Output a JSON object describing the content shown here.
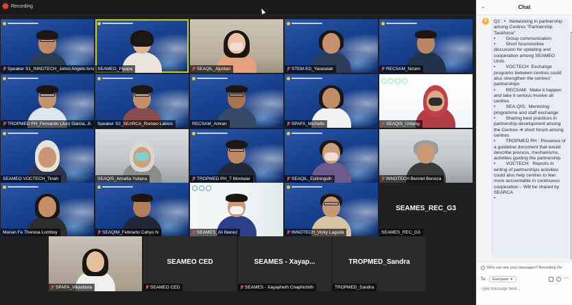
{
  "topbar": {
    "recording_label": "Recording"
  },
  "participants": [
    {
      "name": "Speaker S1_INNOTECH_Jelico Angelo Arresgado",
      "muted": true
    },
    {
      "name": "SEAMEO_Piyapa",
      "muted": false
    },
    {
      "name": "SEAQIL_Ajuntan",
      "muted": true
    },
    {
      "name": "STEM-ED_Yaowalak",
      "muted": true
    },
    {
      "name": "RECSAM_Nizam",
      "muted": true
    },
    {
      "name": "TROPMED PH_Fernando (Jun) Garcia, Jr.",
      "muted": true
    },
    {
      "name": "Speaker S2_SEARCA_Romeo Labios",
      "muted": false
    },
    {
      "name": "RECSAM_Amran",
      "muted": false
    },
    {
      "name": "SPAFA_Michelle",
      "muted": true
    },
    {
      "name": "SEAQIS_Untang",
      "muted": true
    },
    {
      "name": "SEAMEO VOCTECH_Tinah",
      "muted": false
    },
    {
      "name": "SEAQIS_Amallia Yuliana",
      "muted": false
    },
    {
      "name": "TROPMED PH_T Montalar",
      "muted": true
    },
    {
      "name": "SEAQIL_Estiningsih",
      "muted": true
    },
    {
      "name": "INNOTECH Bennet Benoza",
      "muted": true
    },
    {
      "name": "Marian Fe Theresa Lomboy",
      "muted": false
    },
    {
      "name": "SEAQIM_Febriarto Cahyo N",
      "muted": true
    },
    {
      "name": "SEAMES_Ali Ibanez",
      "muted": true
    },
    {
      "name": "INNOTECH_Vicky Laguda",
      "muted": true
    },
    {
      "name": "SEAMES_REC_G3",
      "muted": false,
      "display": "SEAMES_REC_G3"
    }
  ],
  "bottom_row": [
    {
      "name": "SPAFA_Vikantana",
      "muted": true
    },
    {
      "name": "SEAMEO CED",
      "muted": true,
      "display": "SEAMEO CED"
    },
    {
      "name": "SEAMES - Xayapheth Chaphichith",
      "muted": true,
      "display": "SEAMES - Xayap..."
    },
    {
      "name": "TROPMED_Sandra",
      "muted": false,
      "display": "TROPMED_Sandra"
    }
  ],
  "chat": {
    "title": "Chat",
    "avatar_initial": "S",
    "message": "Q2 : •   Networking in partnership among Centres \"Partnership Taskforce\"\n•        Group communication\n•        Short forum/online discussion for updating and cooperation among SEAMEO Units\n•        VOCTECH: Exchange programs between centres could also strengthen the centres' partnerships\n•        RECSAM:  Make it happen and take it serious involve all centres\n•        SEA-QIS:  Mentoring programme and staff exchange\n•        Sharing best practices in partnership development among the Centres ➔ short forum among centres\n•        TROPMED PH : Presence of a guideline document that would describe process, mechanisms, activities guiding the partnership\n•        VOCTECH:  Reports in writing of partnerships activities could also help centres to feel more accountable in continuous cooperation – Will be shared by SEARCA\n•",
    "privacy_notice": "Who can see your messages? Recording On",
    "to_label": "To:",
    "recipient": "Everyone",
    "input_placeholder": "Type message here..."
  },
  "colors": {
    "active_speaker": "#c7d600",
    "muted_mic": "#e8453c",
    "chat_avatar": "#f0b232"
  }
}
